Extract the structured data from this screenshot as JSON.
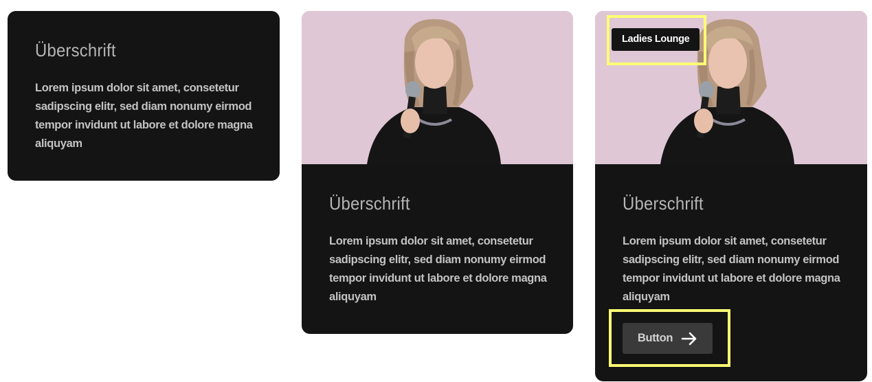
{
  "cards": [
    {
      "title": "Überschrift",
      "text": "Lorem ipsum dolor sit amet, consetetur sadipscing elitr, sed diam nonumy eirmod tempor invidunt ut labore et dolore magna aliquyam"
    },
    {
      "title": "Überschrift",
      "text": "Lorem ipsum dolor sit amet, consetetur sadipscing elitr, sed diam nonumy eirmod tempor invidunt ut labore et dolore magna aliquyam"
    },
    {
      "title": "Überschrift",
      "text": "Lorem ipsum dolor sit amet, consetetur sadipscing elitr, sed diam nonumy eirmod tempor invidunt ut labore et dolore magna aliquyam",
      "tag": "Ladies Lounge",
      "button_label": "Button",
      "button_icon": "arrow-right-icon"
    }
  ],
  "colors": {
    "card_bg": "#141414",
    "button_bg": "#3a3a3a",
    "highlight": "#ffff73",
    "photo_bg": "#dcc4d2"
  }
}
